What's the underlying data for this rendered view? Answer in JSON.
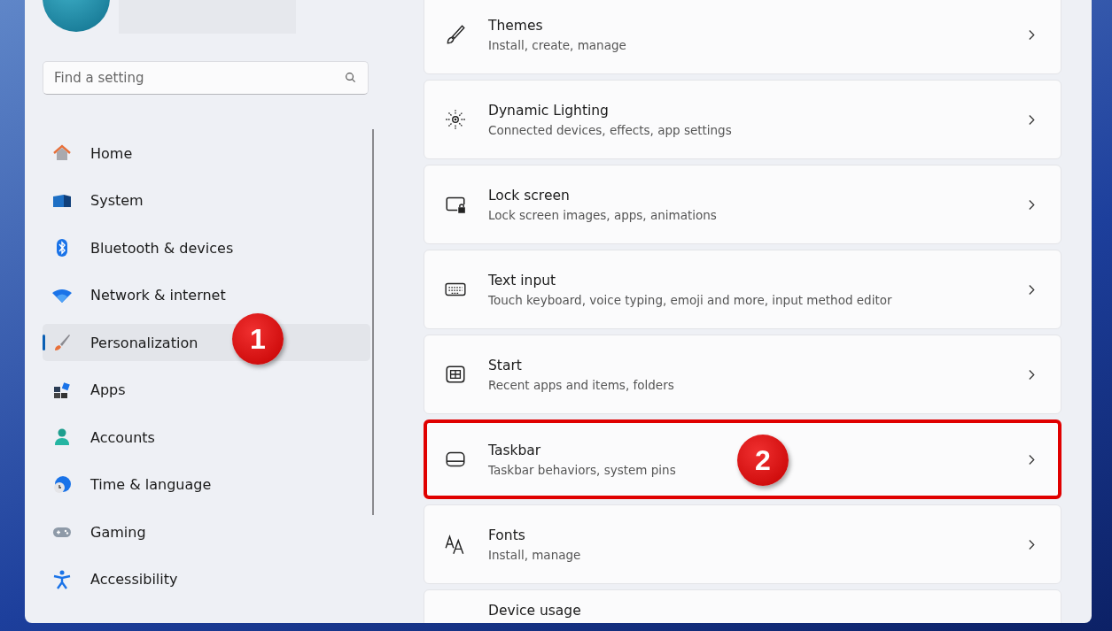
{
  "sidebar": {
    "search": {
      "placeholder": "Find a setting"
    },
    "items": [
      {
        "label": "Home",
        "kind": "home",
        "selected": false
      },
      {
        "label": "System",
        "kind": "system",
        "selected": false
      },
      {
        "label": "Bluetooth & devices",
        "kind": "bluetooth",
        "selected": false
      },
      {
        "label": "Network & internet",
        "kind": "network",
        "selected": false
      },
      {
        "label": "Personalization",
        "kind": "personalization",
        "selected": true,
        "callout": "1"
      },
      {
        "label": "Apps",
        "kind": "apps",
        "selected": false
      },
      {
        "label": "Accounts",
        "kind": "accounts",
        "selected": false
      },
      {
        "label": "Time & language",
        "kind": "time",
        "selected": false
      },
      {
        "label": "Gaming",
        "kind": "gaming",
        "selected": false
      },
      {
        "label": "Accessibility",
        "kind": "accessibility",
        "selected": false
      }
    ]
  },
  "settings": [
    {
      "title": "Themes",
      "description": "Install, create, manage",
      "kind": "brush",
      "highlighted": false
    },
    {
      "title": "Dynamic Lighting",
      "description": "Connected devices, effects, app settings",
      "kind": "lighting",
      "highlighted": false
    },
    {
      "title": "Lock screen",
      "description": "Lock screen images, apps, animations",
      "kind": "lock",
      "highlighted": false
    },
    {
      "title": "Text input",
      "description": "Touch keyboard, voice typing, emoji and more, input method editor",
      "kind": "keyboard",
      "highlighted": false
    },
    {
      "title": "Start",
      "description": "Recent apps and items, folders",
      "kind": "start",
      "highlighted": false
    },
    {
      "title": "Taskbar",
      "description": "Taskbar behaviors, system pins",
      "kind": "taskbar",
      "highlighted": true,
      "callout": "2"
    },
    {
      "title": "Fonts",
      "description": "Install, manage",
      "kind": "fonts",
      "highlighted": false
    },
    {
      "title": "Device usage",
      "kind": "none",
      "highlighted": false
    }
  ]
}
